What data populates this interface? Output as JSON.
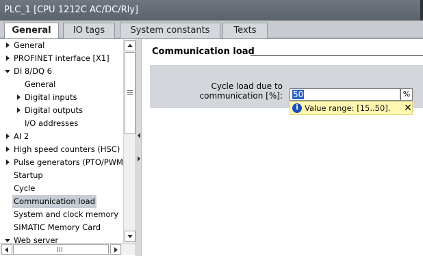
{
  "window": {
    "title": "PLC_1 [CPU 1212C AC/DC/Rly]"
  },
  "tabs": [
    {
      "label": "General",
      "active": true
    },
    {
      "label": "IO tags",
      "active": false
    },
    {
      "label": "System constants",
      "active": false
    },
    {
      "label": "Texts",
      "active": false
    }
  ],
  "tree": {
    "items": [
      {
        "label": "General",
        "level": 0,
        "arrow": "closed"
      },
      {
        "label": "PROFINET interface [X1]",
        "level": 0,
        "arrow": "closed"
      },
      {
        "label": "DI 8/DQ 6",
        "level": 0,
        "arrow": "open"
      },
      {
        "label": "General",
        "level": 1,
        "arrow": "none"
      },
      {
        "label": "Digital inputs",
        "level": 1,
        "arrow": "closed"
      },
      {
        "label": "Digital outputs",
        "level": 1,
        "arrow": "closed"
      },
      {
        "label": "I/O addresses",
        "level": 1,
        "arrow": "none"
      },
      {
        "label": "AI 2",
        "level": 0,
        "arrow": "closed"
      },
      {
        "label": "High speed counters (HSC)",
        "level": 0,
        "arrow": "closed"
      },
      {
        "label": "Pulse generators (PTO/PWM)",
        "level": 0,
        "arrow": "closed"
      },
      {
        "label": "Startup",
        "level": 0,
        "arrow": "none"
      },
      {
        "label": "Cycle",
        "level": 0,
        "arrow": "none"
      },
      {
        "label": "Communication load",
        "level": 0,
        "arrow": "none",
        "selected": true
      },
      {
        "label": "System and clock memory",
        "level": 0,
        "arrow": "none"
      },
      {
        "label": "SIMATIC Memory Card",
        "level": 0,
        "arrow": "none"
      },
      {
        "label": "Web server",
        "level": 0,
        "arrow": "open"
      }
    ]
  },
  "content": {
    "section_title": "Communication load",
    "field": {
      "label_line1": "Cycle load due to",
      "label_line2": "communication [%]:",
      "value": "50",
      "unit": "%"
    },
    "hint": {
      "text": "Value range: [15..50]."
    }
  },
  "colors": {
    "titlebar": "#5b626b",
    "selection": "#2b62c6",
    "hint_background": "#fff6b0",
    "field_panel": "#d3d6da",
    "info_icon": "#1a4fb8"
  }
}
